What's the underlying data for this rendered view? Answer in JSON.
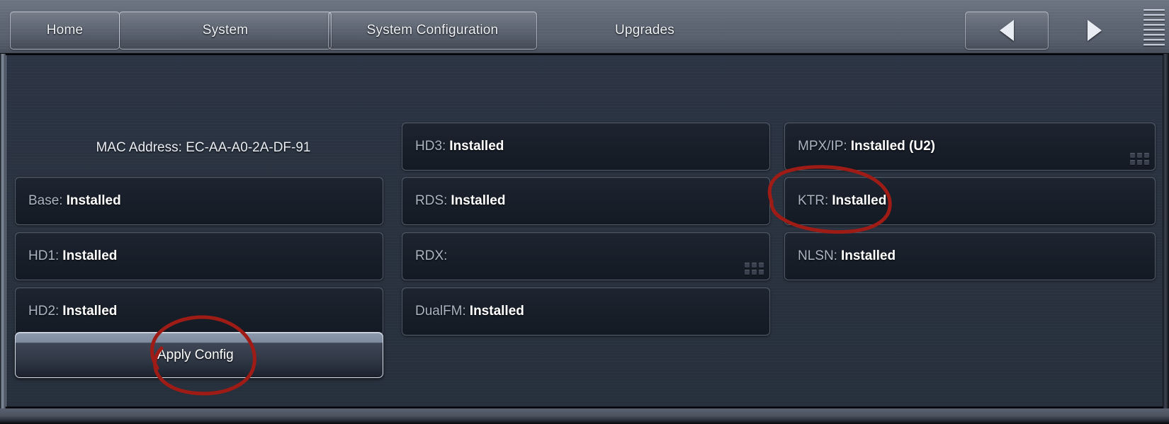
{
  "window": {
    "title": "System Configuration"
  },
  "titlebar": {
    "tabs": [
      {
        "id": "home",
        "label": "Home",
        "active": false,
        "bordered": true
      },
      {
        "id": "system",
        "label": "System",
        "active": false,
        "bordered": true
      },
      {
        "id": "sysconfig",
        "label": "System Configuration",
        "active": true,
        "bordered": true
      },
      {
        "id": "upgrades",
        "label": "Upgrades",
        "active": false,
        "bordered": false
      }
    ],
    "nav": {
      "prev_icon": "triangle-left-icon",
      "next_icon": "triangle-right-icon"
    },
    "menu_grip_icon": "horizontal-lines-grip-icon",
    "menu_grip_lines": 8
  },
  "content": {
    "mac_address_label": "MAC Address:",
    "mac_address_value": "EC-AA-A0-2A-DF-91",
    "columns": [
      {
        "name": "left-column",
        "items": [
          {
            "id": "base",
            "label": "Base:",
            "value": "Installed",
            "grip": false
          },
          {
            "id": "hd1",
            "label": "HD1:",
            "value": "Installed",
            "grip": false
          },
          {
            "id": "hd2",
            "label": "HD2:",
            "value": "Installed",
            "grip": false
          }
        ]
      },
      {
        "name": "middle-column",
        "items": [
          {
            "id": "hd3",
            "label": "HD3:",
            "value": "Installed",
            "grip": false
          },
          {
            "id": "rds",
            "label": "RDS:",
            "value": "Installed",
            "grip": false
          },
          {
            "id": "rdx",
            "label": "RDX:",
            "value": "",
            "grip": true
          },
          {
            "id": "dualfm",
            "label": "DualFM:",
            "value": "Installed",
            "grip": false
          }
        ]
      },
      {
        "name": "right-column",
        "items": [
          {
            "id": "mpxip",
            "label": "MPX/IP:",
            "value": "Installed (U2)",
            "grip": true
          },
          {
            "id": "ktr",
            "label": "KTR:",
            "value": "Installed",
            "grip": false
          },
          {
            "id": "nlsn",
            "label": "NLSN:",
            "value": "Installed",
            "grip": false
          }
        ]
      }
    ],
    "apply_button_label": "Apply Config"
  },
  "annotations": {
    "color": "#9e1c15",
    "marks": [
      {
        "id": "nlsn-circle",
        "target": "nlsn-panel",
        "shape": "hand-drawn-ellipse"
      },
      {
        "id": "apply-circle",
        "target": "apply-config",
        "shape": "hand-drawn-ellipse"
      }
    ]
  },
  "colors": {
    "chrome": "#5e6674",
    "content_bg": "#29323f",
    "panel_bg": "#1a212c",
    "label_text": "#aab4c2",
    "value_text": "#ffffff",
    "annotation_red": "#9e1c15"
  }
}
